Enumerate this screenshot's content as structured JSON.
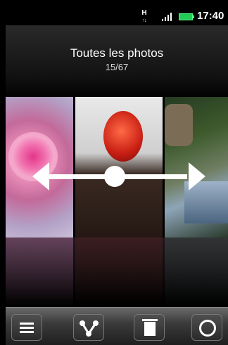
{
  "status_bar": {
    "network_type": "H",
    "network_arrows": "↑↓",
    "clock": "17:40"
  },
  "header": {
    "title": "Toutes les photos",
    "counter": "15/67"
  },
  "photos": [
    {
      "name": "rose"
    },
    {
      "name": "lantern"
    },
    {
      "name": "stream"
    }
  ],
  "swipe_hint": {
    "direction": "horizontal"
  },
  "toolbar": {
    "menu_icon": "menu-icon",
    "share_icon": "share-icon",
    "delete_icon": "trash-icon",
    "camera_icon": "camera-icon"
  },
  "colors": {
    "battery": "#22cc55",
    "lantern": "#c81e14"
  }
}
